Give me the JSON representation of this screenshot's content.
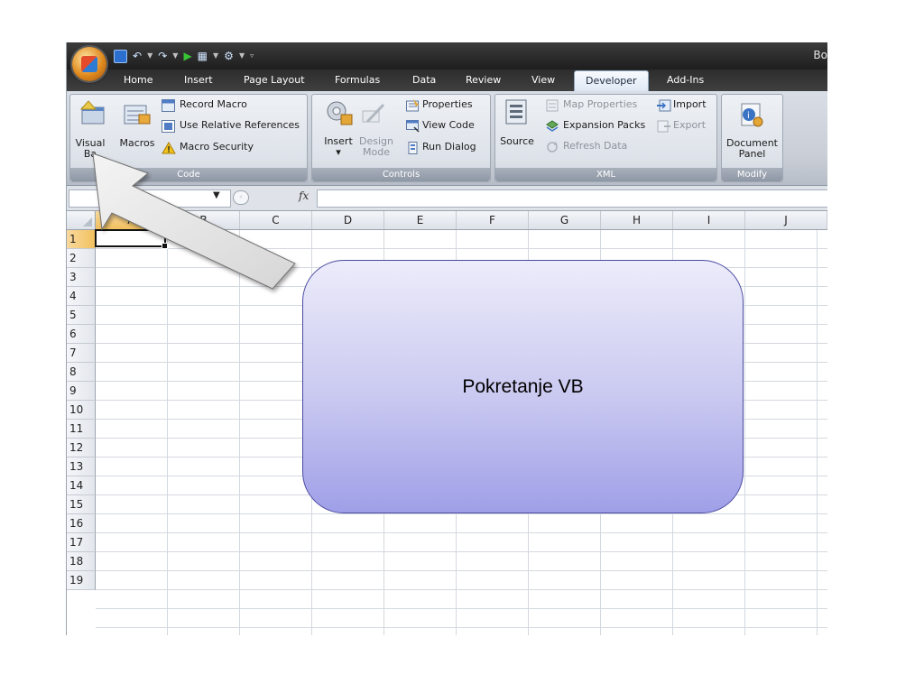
{
  "window": {
    "title_fragment": "Bo"
  },
  "tabs": [
    "Home",
    "Insert",
    "Page Layout",
    "Formulas",
    "Data",
    "Review",
    "View",
    "Developer",
    "Add-Ins"
  ],
  "active_tab": "Developer",
  "ribbon": {
    "code": {
      "label": "Code",
      "visual_basic": "Visual Basic",
      "visual_basic_visible_1": "Visual",
      "visual_basic_visible_2": "Ba",
      "macros": "Macros",
      "record_macro": "Record Macro",
      "use_relative": "Use Relative References",
      "macro_security": "Macro Security"
    },
    "controls": {
      "label": "Controls",
      "insert": "Insert",
      "design_mode_1": "Design",
      "design_mode_2": "Mode",
      "properties": "Properties",
      "view_code": "View Code",
      "run_dialog": "Run Dialog"
    },
    "xml": {
      "label": "XML",
      "source": "Source",
      "map_properties": "Map Properties",
      "expansion_packs": "Expansion Packs",
      "refresh_data": "Refresh Data",
      "import": "Import",
      "export": "Export"
    },
    "modify": {
      "label": "Modify",
      "document_panel_1": "Document",
      "document_panel_2": "Panel"
    }
  },
  "formula_bar": {
    "fx": "fx",
    "value": ""
  },
  "columns": [
    "A",
    "B",
    "C",
    "D",
    "E",
    "F",
    "G",
    "H",
    "I",
    "J"
  ],
  "rows": [
    "1",
    "2",
    "3",
    "4",
    "5",
    "6",
    "7",
    "8",
    "9",
    "10",
    "11",
    "12",
    "13",
    "14",
    "15",
    "16",
    "17",
    "18",
    "19"
  ],
  "active_cell": "A1",
  "callout": {
    "text": "Pokretanje VB"
  },
  "colors": {
    "callout_top": "#ececfb",
    "callout_bottom": "#9f9fe8",
    "active_tab_bg": "#dfe8f4",
    "title_bar": "#2b2b2b"
  }
}
